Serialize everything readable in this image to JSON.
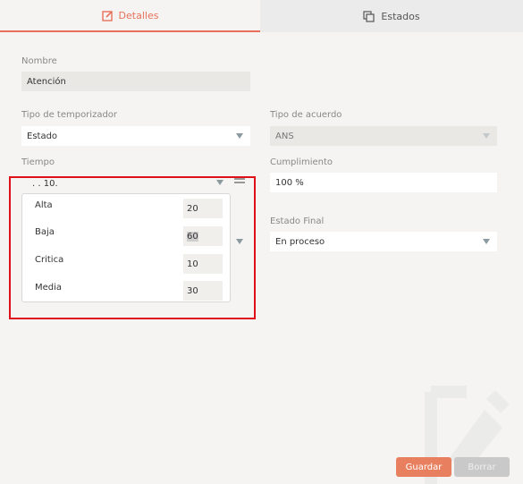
{
  "tabs": {
    "details": "Detalles",
    "states": "Estados"
  },
  "form": {
    "name_label": "Nombre",
    "name_value": "Atención",
    "timer_type_label": "Tipo de temporizador",
    "timer_type_value": "Estado",
    "agreement_label": "Tipo de acuerdo",
    "agreement_value": "ANS",
    "time_label": "Tiempo",
    "time_value": ". . 10.",
    "compliance_label": "Cumplimiento",
    "compliance_value": "100 %",
    "final_state_label": "Estado Final",
    "final_state_value": "En proceso"
  },
  "priorities": [
    {
      "label": "Alta",
      "value": "20"
    },
    {
      "label": "Baja",
      "value": "60"
    },
    {
      "label": "Critica",
      "value": "10"
    },
    {
      "label": "Media",
      "value": "30"
    }
  ],
  "buttons": {
    "save": "Guardar",
    "delete": "Borrar"
  },
  "colors": {
    "accent": "#e8705a",
    "highlight": "#e0101a"
  }
}
